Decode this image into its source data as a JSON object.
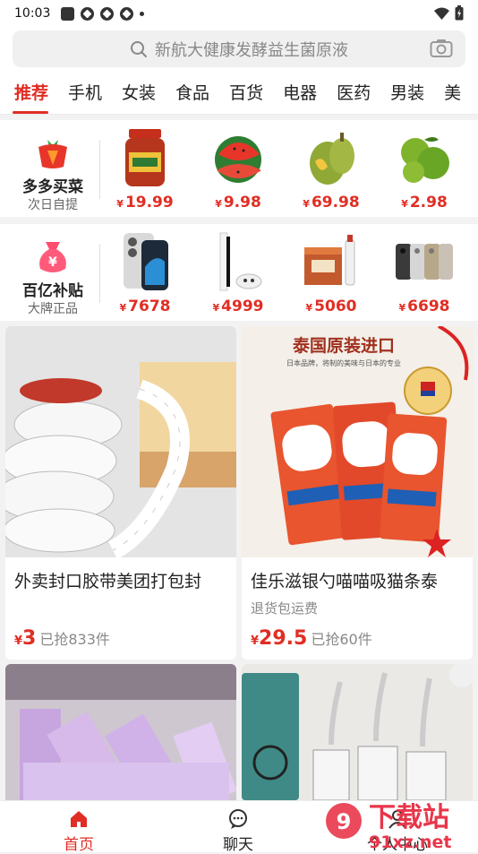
{
  "status": {
    "time": "10:03"
  },
  "search": {
    "placeholder": "新航大健康发酵益生菌原液"
  },
  "tabs": [
    "推荐",
    "手机",
    "女装",
    "食品",
    "百货",
    "电器",
    "医药",
    "男装",
    "美"
  ],
  "section1": {
    "title": "多多买菜",
    "subtitle": "次日自提",
    "items": [
      {
        "name": "sauce-jar",
        "yen": "¥",
        "price": "19.99"
      },
      {
        "name": "watermelon",
        "yen": "¥",
        "price": "9.98"
      },
      {
        "name": "durian",
        "yen": "¥",
        "price": "69.98"
      },
      {
        "name": "green-fruit",
        "yen": "¥",
        "price": "2.98"
      }
    ]
  },
  "section2": {
    "title": "百亿补贴",
    "subtitle": "大牌正品",
    "items": [
      {
        "name": "iphone",
        "yen": "¥",
        "price": "7678"
      },
      {
        "name": "game-console",
        "yen": "¥",
        "price": "4999"
      },
      {
        "name": "liquor-box",
        "yen": "¥",
        "price": "5060"
      },
      {
        "name": "iphone-colors",
        "yen": "¥",
        "price": "6698"
      }
    ]
  },
  "cards": [
    {
      "title": "外卖封口胶带美团打包封",
      "subtitle": "",
      "yen": "¥",
      "price": "3",
      "sold": "已抢833件"
    },
    {
      "banner": "泰国原装进口",
      "banner_sub": "日本品牌，将制的美味与日本的专业",
      "title": "佳乐滋银勺喵喵吸猫条泰",
      "subtitle": "退货包运费",
      "yen": "¥",
      "price": "29.5",
      "sold": "已抢60件"
    }
  ],
  "nav": [
    {
      "label": "首页",
      "icon": "home-icon"
    },
    {
      "label": "聊天",
      "icon": "chat-icon"
    },
    {
      "label": "个人中心",
      "icon": "person-icon"
    }
  ],
  "watermark": {
    "text": "下载站",
    "url": "91xz.net"
  },
  "colors": {
    "accent": "#e02e24"
  }
}
